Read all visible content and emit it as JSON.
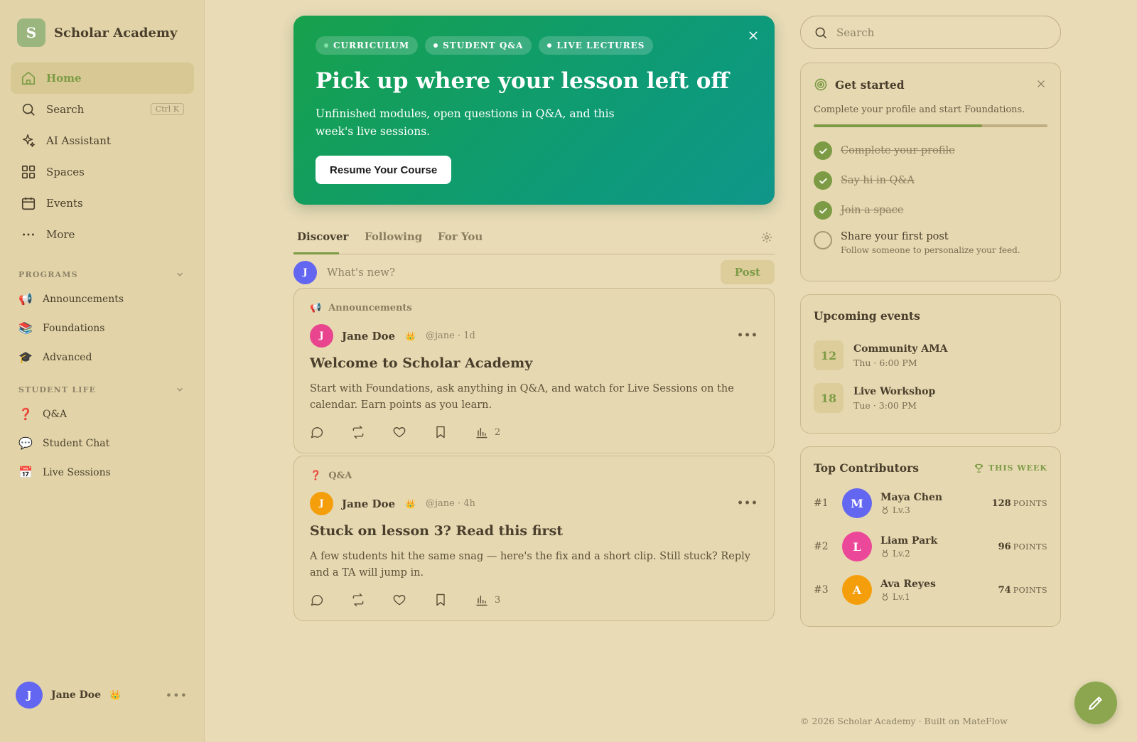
{
  "brand": {
    "initial": "S",
    "name": "Scholar Academy"
  },
  "nav": [
    {
      "label": "Home",
      "icon": "home-icon"
    },
    {
      "label": "Search",
      "icon": "search-icon",
      "shortcut": "Ctrl K"
    },
    {
      "label": "AI Assistant",
      "icon": "sparkle-icon"
    },
    {
      "label": "Spaces",
      "icon": "grid-icon"
    },
    {
      "label": "Events",
      "icon": "calendar-icon"
    },
    {
      "label": "More",
      "icon": "more-icon"
    }
  ],
  "programs": {
    "heading": "PROGRAMS",
    "items": [
      {
        "label": "Announcements",
        "emoji": "📢"
      },
      {
        "label": "Foundations",
        "emoji": "📚"
      },
      {
        "label": "Advanced",
        "emoji": "🎓"
      }
    ]
  },
  "student_life": {
    "heading": "STUDENT LIFE",
    "items": [
      {
        "label": "Q&A",
        "emoji": "❓"
      },
      {
        "label": "Student Chat",
        "emoji": "💬"
      },
      {
        "label": "Live Sessions",
        "emoji": "📅"
      }
    ]
  },
  "current_user": {
    "initial": "J",
    "name": "Jane Doe",
    "badge": "👑"
  },
  "hero": {
    "pills": [
      "CURRICULUM",
      "STUDENT Q&A",
      "LIVE LECTURES"
    ],
    "title": "Pick up where your lesson left off",
    "description": "Unfinished modules, open questions in Q&A, and this week's live sessions.",
    "button": "Resume Your Course"
  },
  "tabs": [
    "Discover",
    "Following",
    "For You"
  ],
  "composer": {
    "avatar": "J",
    "placeholder": "What's new?",
    "post_label": "Post"
  },
  "posts": [
    {
      "category": "Announcements",
      "category_emoji": "📢",
      "author_initial": "J",
      "author": "Jane Doe",
      "badge": "👑",
      "handle": "@jane · 1d",
      "title": "Welcome to Scholar Academy",
      "body": "Start with Foundations, ask anything in Q&A, and watch for Live Sessions on the calendar. Earn points as you learn.",
      "views": "2",
      "avatar_color": "#e8458e"
    },
    {
      "category": "Q&A",
      "category_emoji": "❓",
      "author_initial": "J",
      "author": "Jane Doe",
      "badge": "👑",
      "handle": "@jane · 4h",
      "title": "Stuck on lesson 3? Read this first",
      "body": "A few students hit the same snag — here's the fix and a short clip. Still stuck? Reply and a TA will jump in.",
      "views": "3",
      "avatar_color": "#f59e0b"
    }
  ],
  "search": {
    "placeholder": "Search"
  },
  "get_started": {
    "title": "Get started",
    "description": "Complete your profile and start Foundations.",
    "progress": 0.72,
    "tasks": [
      {
        "label": "Complete your profile",
        "done": true
      },
      {
        "label": "Say hi in Q&A",
        "done": true
      },
      {
        "label": "Join a space",
        "done": true
      },
      {
        "label": "Share your first post",
        "done": false,
        "sub": "Follow someone to personalize your feed."
      }
    ]
  },
  "events": {
    "title": "Upcoming events",
    "items": [
      {
        "day": "12",
        "title": "Community AMA",
        "time": "Thu · 6:00 PM"
      },
      {
        "day": "18",
        "title": "Live Workshop",
        "time": "Tue · 3:00 PM"
      }
    ]
  },
  "contributors": {
    "title": "Top Contributors",
    "period": "THIS WEEK",
    "points_label": "POINTS",
    "items": [
      {
        "rank": "#1",
        "initial": "M",
        "name": "Maya Chen",
        "level": "Lv.3",
        "points": "128",
        "color": "#6366f1"
      },
      {
        "rank": "#2",
        "initial": "L",
        "name": "Liam Park",
        "level": "Lv.2",
        "points": "96",
        "color": "#ec4899"
      },
      {
        "rank": "#3",
        "initial": "A",
        "name": "Ava Reyes",
        "level": "Lv.1",
        "points": "74",
        "color": "#f59e0b"
      }
    ]
  },
  "footer": "© 2026 Scholar Academy · Built on MateFlow",
  "colors": {
    "accent": "#7d9b45",
    "hero_start": "#17a14c",
    "hero_end": "#10968a",
    "user_avatar": "#6366f1"
  }
}
